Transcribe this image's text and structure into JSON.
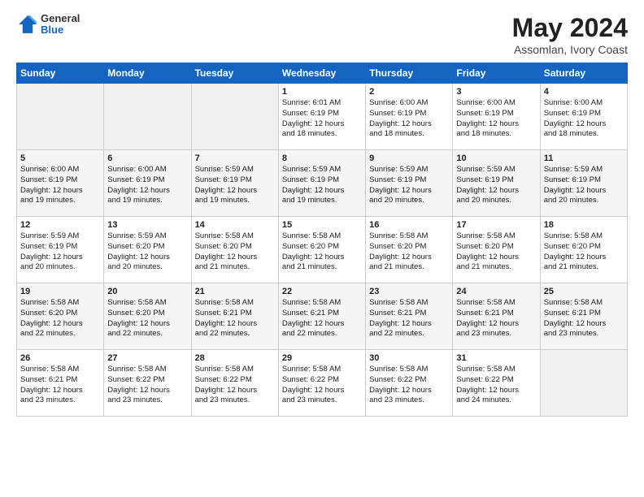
{
  "logo": {
    "line1": "General",
    "line2": "Blue"
  },
  "title": "May 2024",
  "subtitle": "Assomlan, Ivory Coast",
  "days_header": [
    "Sunday",
    "Monday",
    "Tuesday",
    "Wednesday",
    "Thursday",
    "Friday",
    "Saturday"
  ],
  "weeks": [
    [
      {
        "num": "",
        "info": ""
      },
      {
        "num": "",
        "info": ""
      },
      {
        "num": "",
        "info": ""
      },
      {
        "num": "1",
        "info": "Sunrise: 6:01 AM\nSunset: 6:19 PM\nDaylight: 12 hours\nand 18 minutes."
      },
      {
        "num": "2",
        "info": "Sunrise: 6:00 AM\nSunset: 6:19 PM\nDaylight: 12 hours\nand 18 minutes."
      },
      {
        "num": "3",
        "info": "Sunrise: 6:00 AM\nSunset: 6:19 PM\nDaylight: 12 hours\nand 18 minutes."
      },
      {
        "num": "4",
        "info": "Sunrise: 6:00 AM\nSunset: 6:19 PM\nDaylight: 12 hours\nand 18 minutes."
      }
    ],
    [
      {
        "num": "5",
        "info": "Sunrise: 6:00 AM\nSunset: 6:19 PM\nDaylight: 12 hours\nand 19 minutes."
      },
      {
        "num": "6",
        "info": "Sunrise: 6:00 AM\nSunset: 6:19 PM\nDaylight: 12 hours\nand 19 minutes."
      },
      {
        "num": "7",
        "info": "Sunrise: 5:59 AM\nSunset: 6:19 PM\nDaylight: 12 hours\nand 19 minutes."
      },
      {
        "num": "8",
        "info": "Sunrise: 5:59 AM\nSunset: 6:19 PM\nDaylight: 12 hours\nand 19 minutes."
      },
      {
        "num": "9",
        "info": "Sunrise: 5:59 AM\nSunset: 6:19 PM\nDaylight: 12 hours\nand 20 minutes."
      },
      {
        "num": "10",
        "info": "Sunrise: 5:59 AM\nSunset: 6:19 PM\nDaylight: 12 hours\nand 20 minutes."
      },
      {
        "num": "11",
        "info": "Sunrise: 5:59 AM\nSunset: 6:19 PM\nDaylight: 12 hours\nand 20 minutes."
      }
    ],
    [
      {
        "num": "12",
        "info": "Sunrise: 5:59 AM\nSunset: 6:19 PM\nDaylight: 12 hours\nand 20 minutes."
      },
      {
        "num": "13",
        "info": "Sunrise: 5:59 AM\nSunset: 6:20 PM\nDaylight: 12 hours\nand 20 minutes."
      },
      {
        "num": "14",
        "info": "Sunrise: 5:58 AM\nSunset: 6:20 PM\nDaylight: 12 hours\nand 21 minutes."
      },
      {
        "num": "15",
        "info": "Sunrise: 5:58 AM\nSunset: 6:20 PM\nDaylight: 12 hours\nand 21 minutes."
      },
      {
        "num": "16",
        "info": "Sunrise: 5:58 AM\nSunset: 6:20 PM\nDaylight: 12 hours\nand 21 minutes."
      },
      {
        "num": "17",
        "info": "Sunrise: 5:58 AM\nSunset: 6:20 PM\nDaylight: 12 hours\nand 21 minutes."
      },
      {
        "num": "18",
        "info": "Sunrise: 5:58 AM\nSunset: 6:20 PM\nDaylight: 12 hours\nand 21 minutes."
      }
    ],
    [
      {
        "num": "19",
        "info": "Sunrise: 5:58 AM\nSunset: 6:20 PM\nDaylight: 12 hours\nand 22 minutes."
      },
      {
        "num": "20",
        "info": "Sunrise: 5:58 AM\nSunset: 6:20 PM\nDaylight: 12 hours\nand 22 minutes."
      },
      {
        "num": "21",
        "info": "Sunrise: 5:58 AM\nSunset: 6:21 PM\nDaylight: 12 hours\nand 22 minutes."
      },
      {
        "num": "22",
        "info": "Sunrise: 5:58 AM\nSunset: 6:21 PM\nDaylight: 12 hours\nand 22 minutes."
      },
      {
        "num": "23",
        "info": "Sunrise: 5:58 AM\nSunset: 6:21 PM\nDaylight: 12 hours\nand 22 minutes."
      },
      {
        "num": "24",
        "info": "Sunrise: 5:58 AM\nSunset: 6:21 PM\nDaylight: 12 hours\nand 23 minutes."
      },
      {
        "num": "25",
        "info": "Sunrise: 5:58 AM\nSunset: 6:21 PM\nDaylight: 12 hours\nand 23 minutes."
      }
    ],
    [
      {
        "num": "26",
        "info": "Sunrise: 5:58 AM\nSunset: 6:21 PM\nDaylight: 12 hours\nand 23 minutes."
      },
      {
        "num": "27",
        "info": "Sunrise: 5:58 AM\nSunset: 6:22 PM\nDaylight: 12 hours\nand 23 minutes."
      },
      {
        "num": "28",
        "info": "Sunrise: 5:58 AM\nSunset: 6:22 PM\nDaylight: 12 hours\nand 23 minutes."
      },
      {
        "num": "29",
        "info": "Sunrise: 5:58 AM\nSunset: 6:22 PM\nDaylight: 12 hours\nand 23 minutes."
      },
      {
        "num": "30",
        "info": "Sunrise: 5:58 AM\nSunset: 6:22 PM\nDaylight: 12 hours\nand 23 minutes."
      },
      {
        "num": "31",
        "info": "Sunrise: 5:58 AM\nSunset: 6:22 PM\nDaylight: 12 hours\nand 24 minutes."
      },
      {
        "num": "",
        "info": ""
      }
    ]
  ]
}
